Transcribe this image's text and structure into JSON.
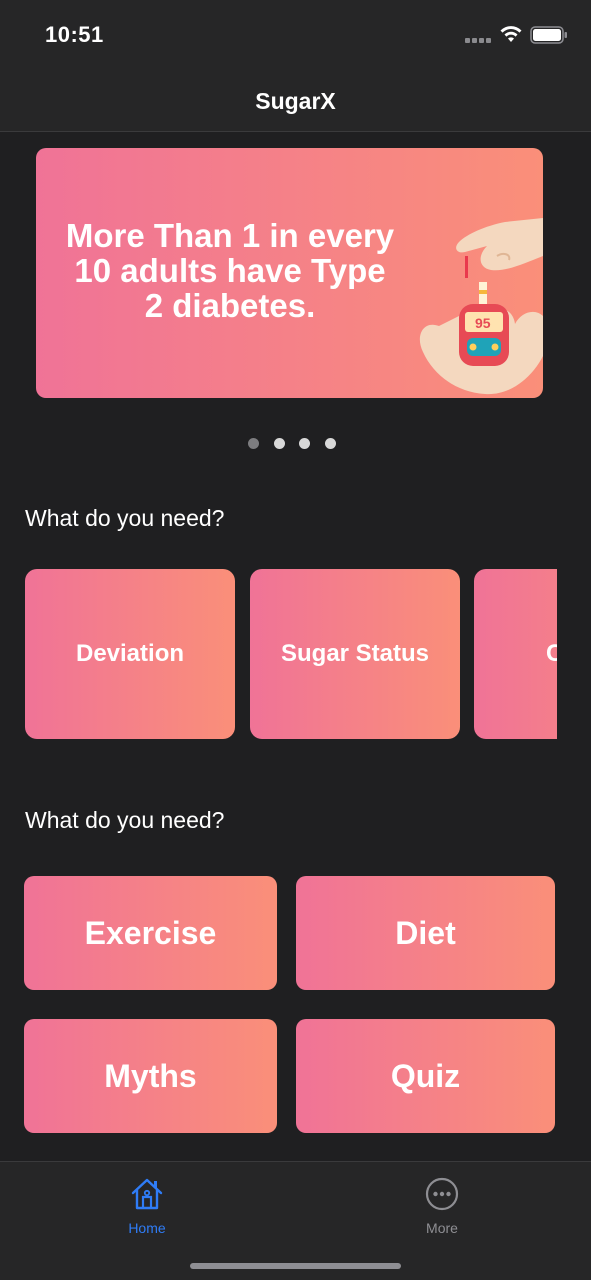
{
  "status_bar": {
    "time": "10:51"
  },
  "header": {
    "title": "SugarX"
  },
  "banner": {
    "lines": [
      "More Than 1  in every",
      "10 adults have Type",
      "2 diabetes."
    ],
    "meter_reading": "95"
  },
  "carousel": {
    "page_count": 4,
    "current_page": 1
  },
  "section_one": {
    "title": "What do you need?",
    "cards": [
      {
        "label": "Deviation"
      },
      {
        "label": "Sugar Status"
      },
      {
        "label": "C"
      }
    ]
  },
  "section_two": {
    "title": "What do you need?",
    "cards": [
      {
        "label": "Exercise"
      },
      {
        "label": "Diet"
      },
      {
        "label": "Myths"
      },
      {
        "label": "Quiz"
      }
    ]
  },
  "tab_bar": {
    "tabs": [
      {
        "label": "Home",
        "icon": "home-icon",
        "active": true
      },
      {
        "label": "More",
        "icon": "more-icon",
        "active": false
      }
    ],
    "active_color": "#2f7cf6",
    "inactive_color": "#8e8e93"
  },
  "colors": {
    "background": "#1f1f21",
    "bar_background": "#262627",
    "gradient_start": "#f07397",
    "gradient_end": "#fa8f79"
  }
}
